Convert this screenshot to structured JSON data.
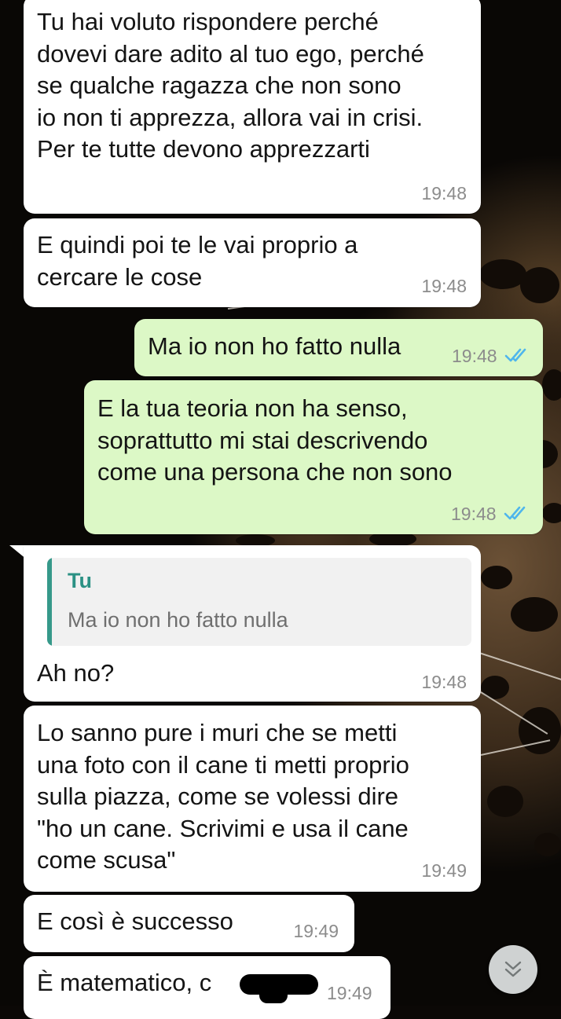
{
  "messages": [
    {
      "direction": "in",
      "text": "Tu hai voluto rispondere perché\ndovevi dare adito al tuo ego, perché\nse qualche ragazza che non sono\nio non ti apprezza, allora vai in crisi.\nPer te tutte devono apprezzarti",
      "time": "19:48"
    },
    {
      "direction": "in",
      "text": "E quindi poi te le vai proprio a\ncercare le cose",
      "time": "19:48"
    },
    {
      "direction": "out",
      "text": "Ma io non ho fatto nulla",
      "time": "19:48",
      "status": "read"
    },
    {
      "direction": "out",
      "text": "E la tua teoria non ha senso,\nsoprattutto mi stai descrivendo\ncome una persona che non sono",
      "time": "19:48",
      "status": "read"
    },
    {
      "direction": "in",
      "text": "Ah no?",
      "time": "19:48",
      "quote": {
        "author": "Tu",
        "text": "Ma io non ho fatto nulla"
      }
    },
    {
      "direction": "in",
      "text": "Lo sanno pure i muri che se metti\nuna foto con il cane ti metti proprio\nsulla piazza, come se volessi dire\n\"ho un cane. Scrivimi e usa il cane\ncome scusa\"",
      "time": "19:49"
    },
    {
      "direction": "in",
      "text": "E così è successo",
      "time": "19:49"
    },
    {
      "direction": "in",
      "text": "È matematico, c",
      "time": "19:49"
    }
  ],
  "colors": {
    "incoming": "#ffffff",
    "outgoing": "#dcf8c6",
    "read_ticks": "#4fb6ec",
    "quote_accent": "#36998a"
  },
  "icons": {
    "read_status": "double-check-icon",
    "scroll_down": "double-chevron-down-icon"
  }
}
